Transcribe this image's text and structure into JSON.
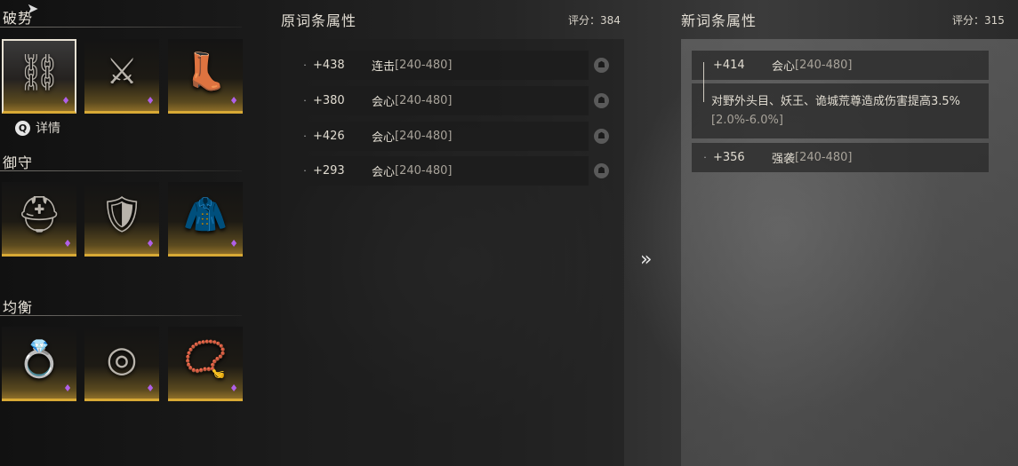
{
  "sections": [
    {
      "title": "破势",
      "items": [
        {
          "icon": "belt-icon",
          "glyph": "⛓",
          "selected": true
        },
        {
          "icon": "bracer-icon",
          "glyph": "⚔"
        },
        {
          "icon": "boots-icon",
          "glyph": "👢"
        }
      ]
    },
    {
      "title": "御守",
      "items": [
        {
          "icon": "helmet-icon",
          "glyph": "⛑"
        },
        {
          "icon": "armor-icon",
          "glyph": "🛡"
        },
        {
          "icon": "cloak-icon",
          "glyph": "🧥"
        }
      ]
    },
    {
      "title": "均衡",
      "items": [
        {
          "icon": "ring-icon",
          "glyph": "💍"
        },
        {
          "icon": "bracelet-icon",
          "glyph": "◎"
        },
        {
          "icon": "necklace-icon",
          "glyph": "📿"
        }
      ]
    }
  ],
  "detail_label": "详情",
  "detail_key": "Q",
  "original": {
    "title": "原词条属性",
    "score": "评分：384",
    "rows": [
      {
        "value": "+438",
        "name": "连击",
        "range": "[240-480]"
      },
      {
        "value": "+380",
        "name": "会心",
        "range": "[240-480]"
      },
      {
        "value": "+426",
        "name": "会心",
        "range": "[240-480]"
      },
      {
        "value": "+293",
        "name": "会心",
        "range": "[240-480]"
      }
    ]
  },
  "new": {
    "title": "新词条属性",
    "score": "评分：315",
    "rows": [
      {
        "value": "+414",
        "name": "会心",
        "range": "[240-480]"
      },
      {
        "value": "+356",
        "name": "强袭",
        "range": "[240-480]"
      }
    ],
    "description": "对野外头目、妖王、诡城荒尊造成伤害提高3.5%",
    "description_range": "[2.0%-6.0%]"
  },
  "arrow": "»",
  "colors": {
    "gold": "#d8a935",
    "gem": "#b060e8"
  }
}
